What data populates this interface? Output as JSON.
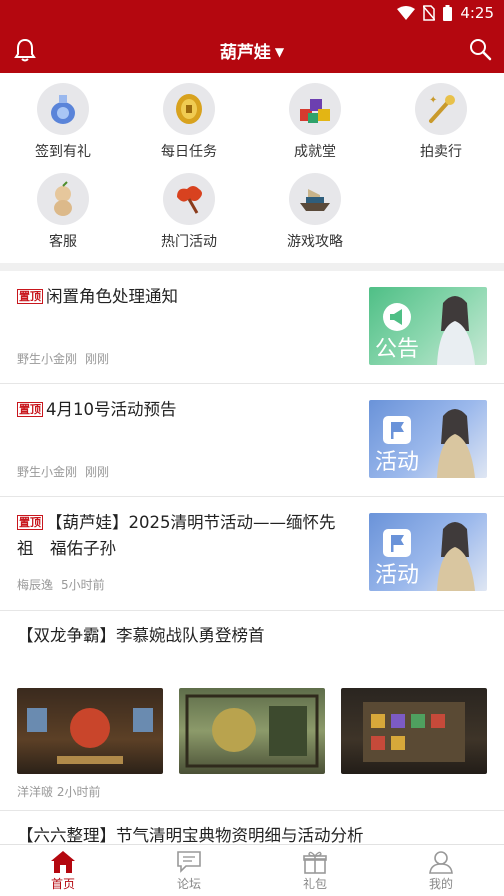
{
  "status_bar": {
    "time": "4:25"
  },
  "header": {
    "title": "葫芦娃"
  },
  "shortcuts": [
    {
      "label": "签到有礼",
      "icon": "potion-bottle-icon"
    },
    {
      "label": "每日任务",
      "icon": "gold-coin-icon"
    },
    {
      "label": "成就堂",
      "icon": "gem-pile-icon"
    },
    {
      "label": "拍卖行",
      "icon": "magic-wand-icon"
    },
    {
      "label": "客服",
      "icon": "gourd-doll-icon"
    },
    {
      "label": "热门活动",
      "icon": "ruyi-cloud-icon"
    },
    {
      "label": "游戏攻略",
      "icon": "ship-icon"
    }
  ],
  "posts": [
    {
      "pinned": "置顶",
      "title": "闲置角色处理通知",
      "author": "野生小金刚",
      "time": "刚刚",
      "thumb_tag": "公告",
      "thumb_color": "#5cc48f"
    },
    {
      "pinned": "置顶",
      "title": "4月10号活动预告",
      "author": "野生小金刚",
      "time": "刚刚",
      "thumb_tag": "活动",
      "thumb_color": "#6f96d8"
    },
    {
      "pinned": "置顶",
      "title_line1": "【葫芦娃】2025清明节活动——缅怀先",
      "title_line2": "祖　福佑子孙",
      "author": "梅辰逸",
      "time": "5小时前",
      "thumb_tag": "活动",
      "thumb_color": "#6f96d8"
    },
    {
      "title": "【双龙争霸】李慕婉战队勇登榜首",
      "meta": "洋洋啵 2小时前"
    },
    {
      "title": "【六六整理】节气清明宝典物资明细与活动分析"
    }
  ],
  "tabs": [
    {
      "label": "首页",
      "icon": "home-icon",
      "active": true
    },
    {
      "label": "论坛",
      "icon": "chat-icon",
      "active": false
    },
    {
      "label": "礼包",
      "icon": "gift-icon",
      "active": false
    },
    {
      "label": "我的",
      "icon": "user-icon",
      "active": false
    }
  ],
  "colors": {
    "brand": "#b4070f",
    "badge": "#c8161d"
  }
}
